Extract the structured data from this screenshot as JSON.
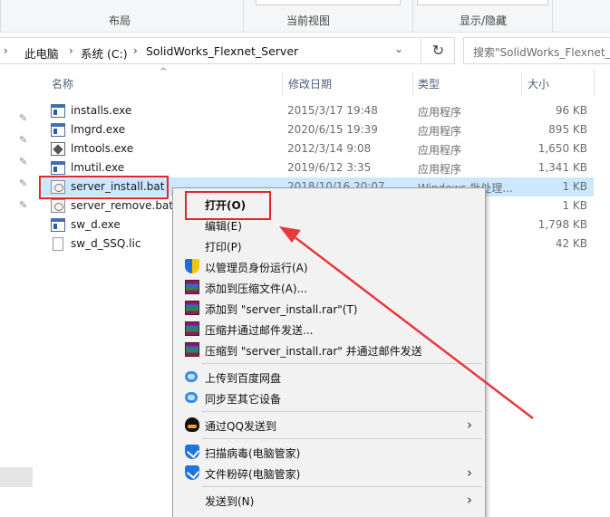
{
  "ribbon": {
    "groups": [
      "布局",
      "当前视图",
      "显示/隐藏"
    ]
  },
  "address": {
    "crumbs": [
      "此电脑",
      "系统 (C:)",
      "SolidWorks_Flexnet_Server"
    ],
    "search_placeholder": "搜索\"SolidWorks_Flexnet_S"
  },
  "columns": {
    "name": "名称",
    "date": "修改日期",
    "type": "类型",
    "size": "大小"
  },
  "files": [
    {
      "name": "installs.exe",
      "date": "2015/3/17 19:48",
      "type": "应用程序",
      "size": "96 KB",
      "icon": "exe-icon"
    },
    {
      "name": "lmgrd.exe",
      "date": "2020/6/15 19:39",
      "type": "应用程序",
      "size": "895 KB",
      "icon": "exe-icon"
    },
    {
      "name": "lmtools.exe",
      "date": "2012/3/14 9:08",
      "type": "应用程序",
      "size": "1,650 KB",
      "icon": "tool-icon"
    },
    {
      "name": "lmutil.exe",
      "date": "2019/6/12 3:35",
      "type": "应用程序",
      "size": "1,341 KB",
      "icon": "exe-icon"
    },
    {
      "name": "server_install.bat",
      "date": "2018/10/16 20:07",
      "type": "Windows 批处理...",
      "size": "1 KB",
      "icon": "bat-icon",
      "selected": true
    },
    {
      "name": "server_remove.bat",
      "date": "",
      "type": "处理...",
      "size": "1 KB",
      "icon": "bat-icon"
    },
    {
      "name": "sw_d.exe",
      "date": "",
      "type": "",
      "size": "1,798 KB",
      "icon": "exe-icon"
    },
    {
      "name": "sw_d_SSQ.lic",
      "date": "",
      "type": "",
      "size": "42 KB",
      "icon": "file-icon"
    }
  ],
  "context_menu": {
    "items": [
      {
        "label": "打开(O)"
      },
      {
        "label": "编辑(E)"
      },
      {
        "label": "打印(P)"
      },
      {
        "label": "以管理员身份运行(A)",
        "icon": "uac-shield-icon"
      },
      {
        "label": "添加到压缩文件(A)...",
        "icon": "winrar-icon"
      },
      {
        "label": "添加到 \"server_install.rar\"(T)",
        "icon": "winrar-icon"
      },
      {
        "label": "压缩并通过邮件发送...",
        "icon": "winrar-icon"
      },
      {
        "label": "压缩到 \"server_install.rar\" 并通过邮件发送",
        "icon": "winrar-icon"
      },
      {
        "label": "上传到百度网盘",
        "icon": "baidu-netdisk-icon"
      },
      {
        "label": "同步至其它设备",
        "icon": "baidu-netdisk-icon"
      },
      {
        "label": "通过QQ发送到",
        "icon": "qq-icon"
      },
      {
        "label": "扫描病毒(电脑管家)",
        "icon": "pc-manager-icon"
      },
      {
        "label": "文件粉碎(电脑管家)",
        "icon": "pc-manager-icon"
      },
      {
        "label": "发送到(N)"
      }
    ]
  },
  "colors": {
    "highlight": "#e0282e",
    "selection": "#cce8ff",
    "menu_bg": "#f2f2f2"
  }
}
